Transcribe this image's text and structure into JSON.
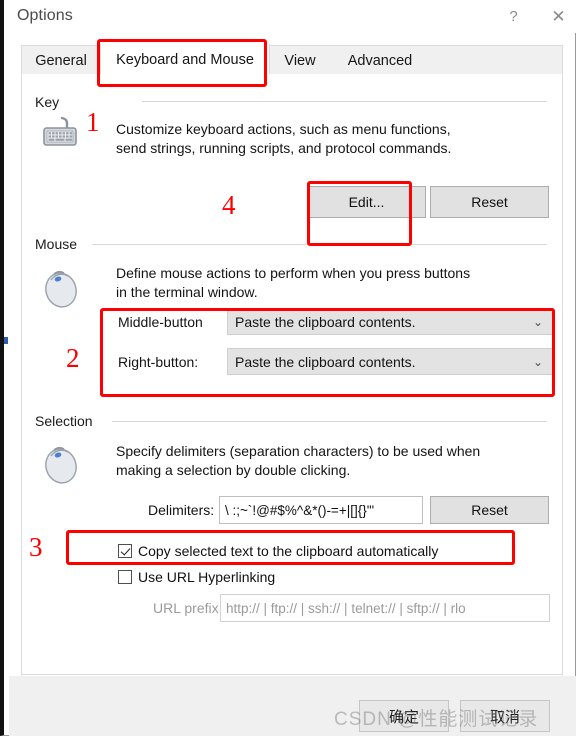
{
  "window": {
    "title": "Options",
    "help_icon": "question-mark-icon",
    "close_icon": "close-x-icon",
    "help_glyph": "?",
    "close_glyph": "✕"
  },
  "tabs": [
    {
      "label": "General",
      "selected": false
    },
    {
      "label": "Keyboard and Mouse",
      "selected": true
    },
    {
      "label": "View",
      "selected": false
    },
    {
      "label": "Advanced",
      "selected": false
    }
  ],
  "key_section": {
    "group_label": "Key",
    "icon": "keyboard-icon",
    "description_line1": "Customize keyboard actions, such as menu functions,",
    "description_line2": "send strings, running scripts,  and protocol commands.",
    "edit_button": "Edit...",
    "edit_mnemonic": "E",
    "reset_button": "Reset",
    "reset_mnemonic": "R"
  },
  "mouse_section": {
    "group_label": "Mouse",
    "icon": "mouse-icon",
    "description_line1": "Define mouse actions to perform when you press buttons",
    "description_line2": "in the terminal window.",
    "middle_label": "Middle-button",
    "middle_mnemonic": "M",
    "middle_value": "Paste the clipboard contents.",
    "right_label": "Right-button:",
    "right_mnemonic": "R",
    "right_value": "Paste the clipboard contents.",
    "chevron": "⌄"
  },
  "selection_section": {
    "group_label": "Selection",
    "icon": "mouse-icon",
    "description_line1": "Specify delimiters (separation characters) to be used when",
    "description_line2": "making a selection by double clicking.",
    "delimiters_label": "Delimiters:",
    "delimiters_mnemonic": "D",
    "delimiters_value": "\\ :;~`!@#$%^&*()-=+|[]{}'\"",
    "delimiters_reset_button": "Reset",
    "delimiters_reset_mnemonic": "s",
    "copy_checkbox_label": "Copy selected text to the clipboard automatically",
    "copy_checkbox_mnemonic": "C",
    "copy_checkbox_checked": true,
    "url_checkbox_label": "Use URL Hyperlinking",
    "url_checkbox_mnemonic": "H",
    "url_checkbox_checked": false,
    "url_prefix_label": "URL prefix:",
    "url_prefix_value": "http:// | ftp:// | ssh:// | telnet:// | sftp:// | rlo"
  },
  "footer": {
    "ok_button": "确定",
    "cancel_button": "取消",
    "watermark": "CSDN @性能测试记录"
  },
  "annotations": {
    "callout_1": "1",
    "callout_2": "2",
    "callout_3": "3",
    "callout_4": "4",
    "color": "#fe0000"
  }
}
